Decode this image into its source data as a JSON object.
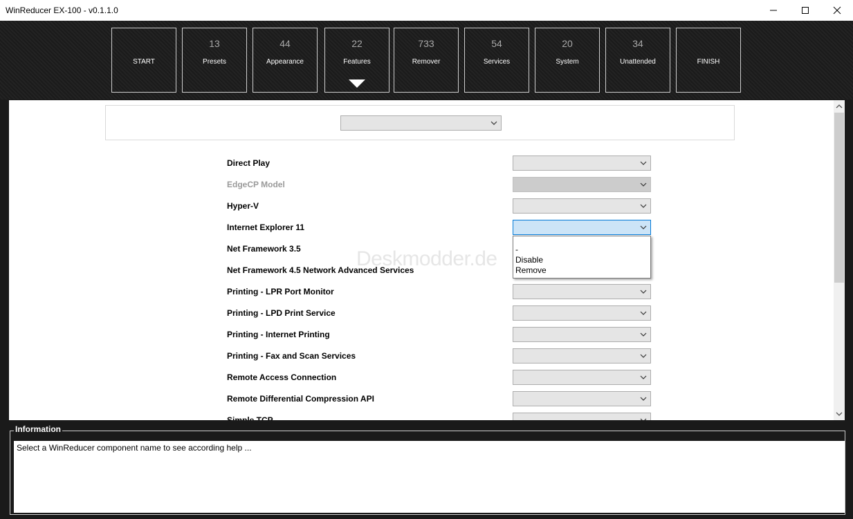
{
  "window": {
    "title": "WinReducer EX-100 - v0.1.1.0"
  },
  "nav": [
    {
      "count": "",
      "label": "START"
    },
    {
      "count": "13",
      "label": "Presets"
    },
    {
      "count": "44",
      "label": "Appearance"
    },
    {
      "count": "22",
      "label": "Features",
      "active": true
    },
    {
      "count": "733",
      "label": "Remover"
    },
    {
      "count": "54",
      "label": "Services"
    },
    {
      "count": "20",
      "label": "System"
    },
    {
      "count": "34",
      "label": "Unattended"
    },
    {
      "count": "",
      "label": "FINISH"
    }
  ],
  "features": [
    {
      "label": "Direct Play",
      "value": "",
      "state": "normal"
    },
    {
      "label": "EdgeCP Model",
      "value": "",
      "state": "disabled"
    },
    {
      "label": "Hyper-V",
      "value": "",
      "state": "normal"
    },
    {
      "label": "Internet Explorer 11",
      "value": "",
      "state": "open"
    },
    {
      "label": "Net Framework 3.5",
      "value": "",
      "state": "hidden"
    },
    {
      "label": "Net Framework 4.5 Network Advanced Services",
      "value": "",
      "state": "hidden"
    },
    {
      "label": "Printing - LPR Port Monitor",
      "value": "",
      "state": "normal"
    },
    {
      "label": "Printing - LPD Print Service",
      "value": "",
      "state": "normal"
    },
    {
      "label": "Printing - Internet Printing",
      "value": "",
      "state": "normal"
    },
    {
      "label": "Printing - Fax and Scan Services",
      "value": "",
      "state": "normal"
    },
    {
      "label": "Remote Access Connection",
      "value": "",
      "state": "normal"
    },
    {
      "label": "Remote Differential Compression API",
      "value": "",
      "state": "normal"
    },
    {
      "label": "Simple TCP",
      "value": "",
      "state": "normal"
    }
  ],
  "dropdown_options": [
    "-",
    "Disable",
    "Remove"
  ],
  "watermark": "Deskmodder.de",
  "info": {
    "title": "Information",
    "text": "Select a WinReducer component name to see according help ..."
  },
  "colors": {
    "active_combo": "#cce4f7",
    "accent_border": "#0078d7"
  }
}
